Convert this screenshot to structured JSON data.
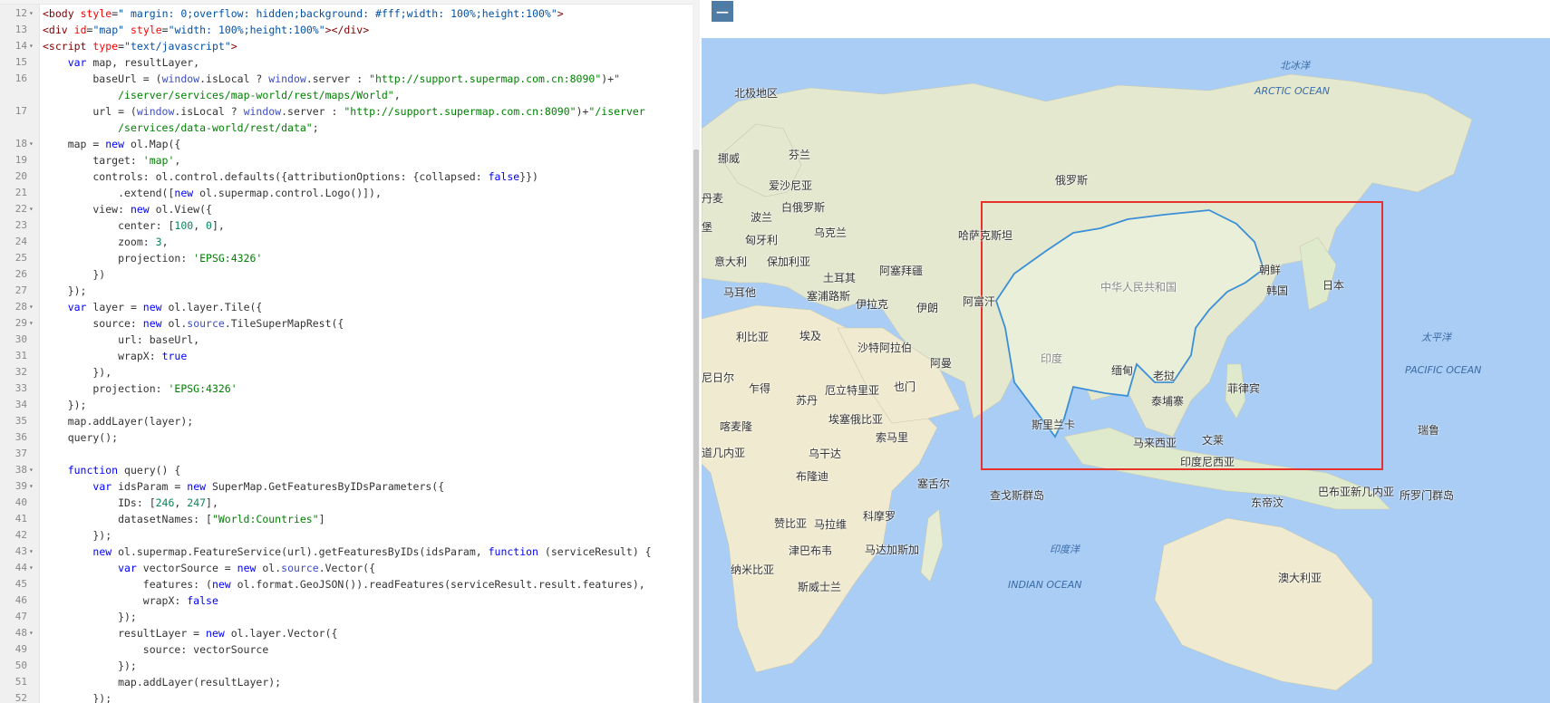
{
  "editor": {
    "lines": [
      {
        "n": "12",
        "fold": true,
        "html": "<span class=\"t\">&lt;body</span> <span class=\"a\">style</span>=<span class=\"v\">\" margin: 0;overflow: hidden;background: #fff;width: 100%;height:100%\"</span><span class=\"t\">&gt;</span>"
      },
      {
        "n": "13",
        "fold": false,
        "html": "<span class=\"t\">&lt;div</span> <span class=\"a\">id</span>=<span class=\"v\">\"map\"</span> <span class=\"a\">style</span>=<span class=\"v\">\"width: 100%;height:100%\"</span><span class=\"t\">&gt;&lt;/div&gt;</span>"
      },
      {
        "n": "14",
        "fold": true,
        "html": "<span class=\"t\">&lt;script</span> <span class=\"a\">type</span>=<span class=\"v\">\"text/javascript\"</span><span class=\"t\">&gt;</span>"
      },
      {
        "n": "15",
        "fold": false,
        "html": "    <span class=\"k\">var</span> map, resultLayer,"
      },
      {
        "n": "16",
        "fold": false,
        "html": "        baseUrl = (<span class=\"b\">window</span>.isLocal ? <span class=\"b\">window</span>.server : <span class=\"s\">\"http://support.supermap.com.cn:8090\"</span>)+<span class=\"s\">\"</span>"
      },
      {
        "n": "",
        "fold": false,
        "html": "            <span class=\"s\">/iserver/services/map-world/rest/maps/World\"</span>,"
      },
      {
        "n": "17",
        "fold": false,
        "html": "        url = (<span class=\"b\">window</span>.isLocal ? <span class=\"b\">window</span>.server : <span class=\"s\">\"http://support.supermap.com.cn:8090\"</span>)+<span class=\"s\">\"/iserver</span>"
      },
      {
        "n": "",
        "fold": false,
        "html": "            <span class=\"s\">/services/data-world/rest/data\"</span>;"
      },
      {
        "n": "18",
        "fold": true,
        "html": "    map = <span class=\"k\">new</span> ol.Map({"
      },
      {
        "n": "19",
        "fold": false,
        "html": "        target: <span class=\"s\">'map'</span>,"
      },
      {
        "n": "20",
        "fold": false,
        "html": "        controls: ol.control.defaults({attributionOptions: {collapsed: <span class=\"k\">false</span>}})"
      },
      {
        "n": "21",
        "fold": false,
        "html": "            .extend([<span class=\"k\">new</span> ol.supermap.control.Logo()]),"
      },
      {
        "n": "22",
        "fold": true,
        "html": "        view: <span class=\"k\">new</span> ol.View({"
      },
      {
        "n": "23",
        "fold": false,
        "html": "            center: [<span class=\"n\">100</span>, <span class=\"n\">0</span>],"
      },
      {
        "n": "24",
        "fold": false,
        "html": "            zoom: <span class=\"n\">3</span>,"
      },
      {
        "n": "25",
        "fold": false,
        "html": "            projection: <span class=\"s\">'EPSG:4326'</span>"
      },
      {
        "n": "26",
        "fold": false,
        "html": "        })"
      },
      {
        "n": "27",
        "fold": false,
        "html": "    });"
      },
      {
        "n": "28",
        "fold": true,
        "html": "    <span class=\"k\">var</span> layer = <span class=\"k\">new</span> ol.layer.Tile({"
      },
      {
        "n": "29",
        "fold": true,
        "html": "        source: <span class=\"k\">new</span> ol.<span class=\"b\">source</span>.TileSuperMapRest({"
      },
      {
        "n": "30",
        "fold": false,
        "html": "            url: baseUrl,"
      },
      {
        "n": "31",
        "fold": false,
        "html": "            wrapX: <span class=\"k\">true</span>"
      },
      {
        "n": "32",
        "fold": false,
        "html": "        }),"
      },
      {
        "n": "33",
        "fold": false,
        "html": "        projection: <span class=\"s\">'EPSG:4326'</span>"
      },
      {
        "n": "34",
        "fold": false,
        "html": "    });"
      },
      {
        "n": "35",
        "fold": false,
        "html": "    map.addLayer(layer);"
      },
      {
        "n": "36",
        "fold": false,
        "html": "    query();"
      },
      {
        "n": "37",
        "fold": false,
        "html": ""
      },
      {
        "n": "38",
        "fold": true,
        "html": "    <span class=\"k\">function</span> query() {"
      },
      {
        "n": "39",
        "fold": true,
        "html": "        <span class=\"k\">var</span> idsParam = <span class=\"k\">new</span> SuperMap.GetFeaturesByIDsParameters({"
      },
      {
        "n": "40",
        "fold": false,
        "html": "            IDs: [<span class=\"n\">246</span>, <span class=\"n\">247</span>],"
      },
      {
        "n": "41",
        "fold": false,
        "html": "            datasetNames: [<span class=\"s\">\"World:Countries\"</span>]"
      },
      {
        "n": "42",
        "fold": false,
        "html": "        });"
      },
      {
        "n": "43",
        "fold": true,
        "html": "        <span class=\"k\">new</span> ol.supermap.FeatureService(url).getFeaturesByIDs(idsParam, <span class=\"k\">function</span> (serviceResult) {"
      },
      {
        "n": "44",
        "fold": true,
        "html": "            <span class=\"k\">var</span> vectorSource = <span class=\"k\">new</span> ol.<span class=\"b\">source</span>.Vector({"
      },
      {
        "n": "45",
        "fold": false,
        "html": "                features: (<span class=\"k\">new</span> ol.format.GeoJSON()).readFeatures(serviceResult.result.features),"
      },
      {
        "n": "46",
        "fold": false,
        "html": "                wrapX: <span class=\"k\">false</span>"
      },
      {
        "n": "47",
        "fold": false,
        "html": "            });"
      },
      {
        "n": "48",
        "fold": true,
        "html": "            resultLayer = <span class=\"k\">new</span> ol.layer.Vector({"
      },
      {
        "n": "49",
        "fold": false,
        "html": "                source: vectorSource"
      },
      {
        "n": "50",
        "fold": false,
        "html": "            });"
      },
      {
        "n": "51",
        "fold": false,
        "html": "            map.addLayer(resultLayer);"
      },
      {
        "n": "52",
        "fold": false,
        "html": "        });"
      }
    ]
  },
  "map": {
    "zoom_out_label": "−",
    "labels": [
      {
        "text": "北极地区"
      },
      {
        "text": "芬兰"
      },
      {
        "text": "挪威"
      },
      {
        "text": "丹麦"
      },
      {
        "text": "爱沙尼亚"
      },
      {
        "text": "俄罗斯"
      },
      {
        "text": "白俄罗斯"
      },
      {
        "text": "波兰"
      },
      {
        "text": "堡"
      },
      {
        "text": "匈牙利"
      },
      {
        "text": "乌克兰"
      },
      {
        "text": "哈萨克斯坦"
      },
      {
        "text": "意大利"
      },
      {
        "text": "保加利亚"
      },
      {
        "text": "朝鲜"
      },
      {
        "text": "土耳其"
      },
      {
        "text": "阿塞拜疆"
      },
      {
        "text": "马耳他"
      },
      {
        "text": "塞浦路斯"
      },
      {
        "text": "韩国"
      },
      {
        "text": "日本"
      },
      {
        "text": "阿富汗"
      },
      {
        "text": "伊拉克"
      },
      {
        "text": "伊朗"
      },
      {
        "text": "中华人民共和国"
      },
      {
        "text": "利比亚"
      },
      {
        "text": "埃及"
      },
      {
        "text": "沙特阿拉伯"
      },
      {
        "text": "阿曼"
      },
      {
        "text": "印度"
      },
      {
        "text": "尼日尔"
      },
      {
        "text": "乍得"
      },
      {
        "text": "苏丹"
      },
      {
        "text": "厄立特里亚"
      },
      {
        "text": "也门"
      },
      {
        "text": "缅甸"
      },
      {
        "text": "老挝"
      },
      {
        "text": "菲律宾"
      },
      {
        "text": "泰埔寨"
      },
      {
        "text": "喀麦隆"
      },
      {
        "text": "埃塞俄比亚"
      },
      {
        "text": "斯里兰卡"
      },
      {
        "text": "索马里"
      },
      {
        "text": "马来西亚"
      },
      {
        "text": "文莱"
      },
      {
        "text": "瑞鲁"
      },
      {
        "text": "道几内亚"
      },
      {
        "text": "乌干达"
      },
      {
        "text": "印度尼西亚"
      },
      {
        "text": "布隆迪"
      },
      {
        "text": "塞舌尔"
      },
      {
        "text": "查戈斯群岛"
      },
      {
        "text": "东帝汶"
      },
      {
        "text": "巴布亚新几内亚"
      },
      {
        "text": "所罗门群岛"
      },
      {
        "text": "赞比亚"
      },
      {
        "text": "马拉维"
      },
      {
        "text": "科摩罗"
      },
      {
        "text": "津巴布韦"
      },
      {
        "text": "马达加斯加"
      },
      {
        "text": "纳米比亚"
      },
      {
        "text": "斯威士兰"
      },
      {
        "text": "澳大利亚"
      }
    ],
    "ocean_labels": [
      {
        "text": "北冰洋"
      },
      {
        "text": "ARCTIC OCEAN"
      },
      {
        "text": "太平洋"
      },
      {
        "text": "PACIFIC OCEAN"
      },
      {
        "text": "印度洋"
      },
      {
        "text": "INDIAN OCEAN"
      }
    ]
  }
}
